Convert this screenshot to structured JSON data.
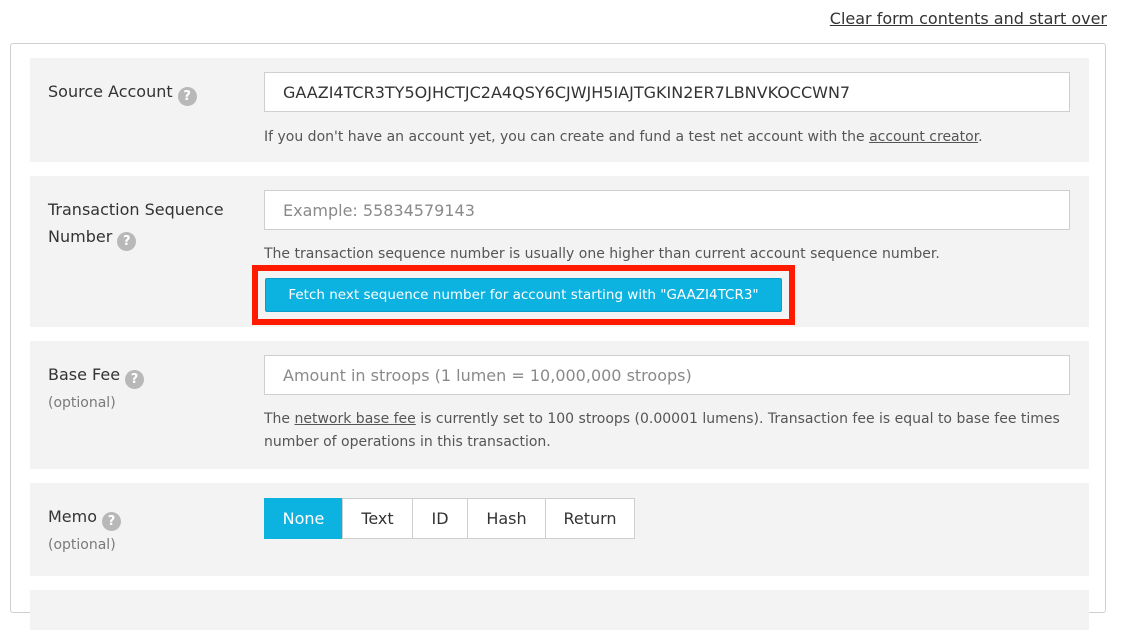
{
  "header": {
    "clear_link": "Clear form contents and start over"
  },
  "source_account": {
    "label": "Source Account",
    "value": "GAAZI4TCR3TY5OJHCTJC2A4QSY6CJWJH5IAJTGKIN2ER7LBNVKOCCWN7",
    "hint_prefix": "If you don't have an account yet, you can create and fund a test net account with the ",
    "hint_link": "account creator",
    "hint_suffix": "."
  },
  "sequence": {
    "label_line1": "Transaction Sequence",
    "label_line2": "Number",
    "placeholder": "Example: 55834579143",
    "hint": "The transaction sequence number is usually one higher than current account sequence number.",
    "fetch_button": "Fetch next sequence number for account starting with \"GAAZI4TCR3\"",
    "highlight_color": "#ff1a00"
  },
  "base_fee": {
    "label": "Base Fee",
    "optional": "(optional)",
    "placeholder": "Amount in stroops (1 lumen = 10,000,000 stroops)",
    "hint_prefix": "The ",
    "hint_link": "network base fee",
    "hint_line1_rest": " is currently set to 100 stroops (0.00001 lumens). Transaction fee is equal to base fee times",
    "hint_line2": "number of operations in this transaction."
  },
  "memo": {
    "label": "Memo",
    "optional": "(optional)",
    "options": [
      "None",
      "Text",
      "ID",
      "Hash",
      "Return"
    ],
    "selected": "None"
  },
  "help_icon": "?",
  "colors": {
    "accent": "#0cb2e0",
    "row_bg": "#f3f3f3"
  }
}
